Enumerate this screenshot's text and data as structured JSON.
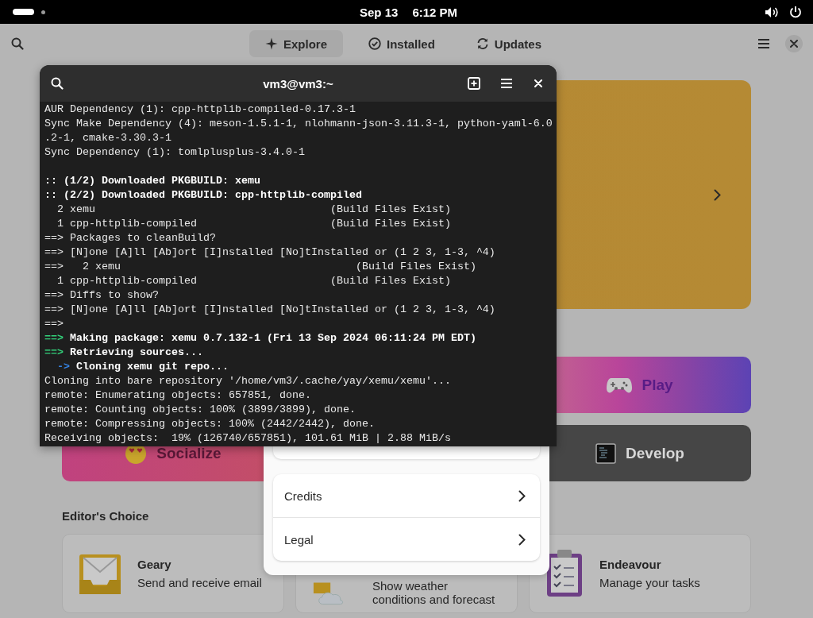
{
  "top_bar": {
    "date": "Sep 13",
    "time": "6:12 PM"
  },
  "app": {
    "tabs": [
      {
        "label": "Explore",
        "kind": "sparkle",
        "selected": true
      },
      {
        "label": "Installed",
        "kind": "check",
        "selected": false
      },
      {
        "label": "Updates",
        "kind": "refresh",
        "selected": false
      }
    ],
    "categories": [
      {
        "label": "Play",
        "kind": "play"
      },
      {
        "label": "Socialize",
        "kind": "socialize"
      },
      {
        "label": "Develop",
        "kind": "develop"
      }
    ],
    "editors_choice": {
      "heading": "Editor's Choice",
      "apps": [
        {
          "name": "Geary",
          "description": "Send and receive email",
          "kind": "mail"
        },
        {
          "description": "Show weather conditions and forecast",
          "kind": "weather"
        },
        {
          "name": "Endeavour",
          "description": "Manage your tasks",
          "kind": "tasks"
        }
      ]
    }
  },
  "dialog": {
    "rows": [
      {
        "label": "Credits"
      },
      {
        "label": "Legal"
      }
    ]
  },
  "terminal": {
    "title": "vm3@vm3:~",
    "lines": [
      {
        "kind": "plain",
        "text": "AUR Dependency (1): cpp-httplib-compiled-0.17.3-1"
      },
      {
        "kind": "plain",
        "text": "Sync Make Dependency (4): meson-1.5.1-1, nlohmann-json-3.11.3-1, python-yaml-6.0"
      },
      {
        "kind": "plain",
        "text": ".2-1, cmake-3.30.3-1"
      },
      {
        "kind": "plain",
        "text": "Sync Dependency (1): tomlplusplus-3.4.0-1"
      },
      {
        "kind": "blank"
      },
      {
        "kind": "bold",
        "text": ":: (1/2) Downloaded PKGBUILD: xemu"
      },
      {
        "kind": "bold",
        "text": ":: (2/2) Downloaded PKGBUILD: cpp-httplib-compiled"
      },
      {
        "kind": "plain",
        "text": "  2 xemu                                     (Build Files Exist)"
      },
      {
        "kind": "plain",
        "text": "  1 cpp-httplib-compiled                     (Build Files Exist)"
      },
      {
        "kind": "plain",
        "text": "==> Packages to cleanBuild?"
      },
      {
        "kind": "plain",
        "text": "==> [N]one [A]ll [Ab]ort [I]nstalled [No]tInstalled or (1 2 3, 1-3, ^4)"
      },
      {
        "kind": "plain",
        "text": "==>   2 xemu                                     (Build Files Exist)"
      },
      {
        "kind": "plain",
        "text": "  1 cpp-httplib-compiled                     (Build Files Exist)"
      },
      {
        "kind": "plain",
        "text": "==> Diffs to show?"
      },
      {
        "kind": "plain",
        "text": "==> [N]one [A]ll [Ab]ort [I]nstalled [No]tInstalled or (1 2 3, 1-3, ^4)"
      },
      {
        "kind": "plain",
        "text": "==>"
      },
      {
        "kind": "status",
        "prefix": "==>",
        "text": "Making package: xemu 0.7.132-1 (Fri 13 Sep 2024 06:11:24 PM EDT)"
      },
      {
        "kind": "status",
        "prefix": "==>",
        "text": "Retrieving sources..."
      },
      {
        "kind": "substatus",
        "prefix": "  ->",
        "text": "Cloning xemu git repo..."
      },
      {
        "kind": "plain",
        "text": "Cloning into bare repository '/home/vm3/.cache/yay/xemu/xemu'..."
      },
      {
        "kind": "plain",
        "text": "remote: Enumerating objects: 657851, done."
      },
      {
        "kind": "plain",
        "text": "remote: Counting objects: 100% (3899/3899), done."
      },
      {
        "kind": "plain",
        "text": "remote: Compressing objects: 100% (2442/2442), done."
      },
      {
        "kind": "plain",
        "text": "Receiving objects:  19% (126740/657851), 101.61 MiB | 2.88 MiB/s"
      }
    ]
  }
}
